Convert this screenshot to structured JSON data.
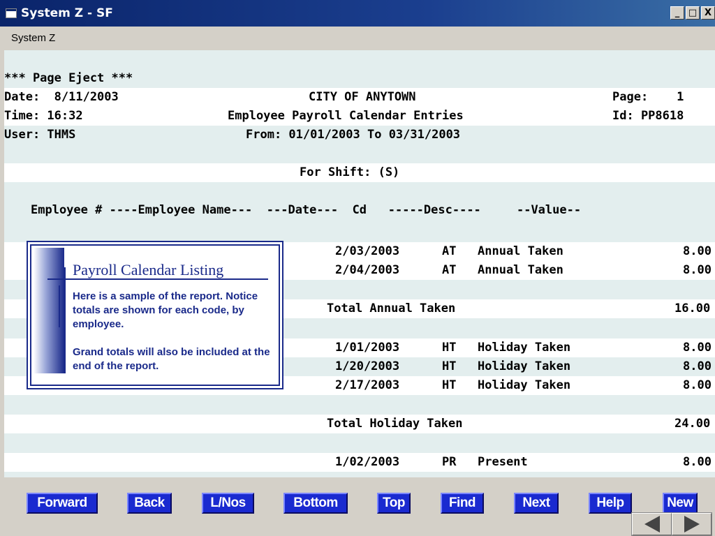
{
  "window": {
    "title": "System Z - SF",
    "minimize": "_",
    "maximize": "□",
    "close": "X"
  },
  "menu": {
    "system": "System Z"
  },
  "report": {
    "page_eject": "*** Page Eject ***",
    "date_label": "Date:  8/11/2003",
    "city": "CITY OF ANYTOWN",
    "page_label": "Page:    1",
    "time_label": "Time: 16:32",
    "report_title": "Employee Payroll Calendar Entries",
    "id_label": "Id: PP8618",
    "user_label": "User: THMS",
    "range": "From: 01/01/2003 To 03/31/2003",
    "shift": "For Shift: (S)",
    "col_header": "Employee # ----Employee Name---  ---Date---  Cd   -----Desc----     --Value--",
    "rows": [
      {
        "date": "2/03/2003",
        "cd": "AT",
        "desc": "Annual Taken",
        "value": "8.00"
      },
      {
        "date": "2/04/2003",
        "cd": "AT",
        "desc": "Annual Taken",
        "value": "8.00"
      },
      {
        "total_label": "Total Annual Taken",
        "value": "16.00"
      },
      {
        "date": "1/01/2003",
        "cd": "HT",
        "desc": "Holiday Taken",
        "value": "8.00"
      },
      {
        "date": "1/20/2003",
        "cd": "HT",
        "desc": "Holiday Taken",
        "value": "8.00"
      },
      {
        "date": "2/17/2003",
        "cd": "HT",
        "desc": "Holiday Taken",
        "value": "8.00"
      },
      {
        "total_label": "Total Holiday Taken",
        "value": "24.00"
      },
      {
        "date": "1/02/2003",
        "cd": "PR",
        "desc": "Present",
        "value": "8.00"
      }
    ]
  },
  "callout": {
    "title": "Payroll Calendar Listing",
    "para1": "Here is a sample of the report. Notice totals are shown for each code, by employee.",
    "para2": "Grand totals will also  be included at the end of the report."
  },
  "fkeys": [
    "Forward",
    "Back",
    "L/Nos",
    "Bottom",
    "Top",
    "Find",
    "Next",
    "Help",
    "New"
  ],
  "icons": {
    "prev": "prev-slide-icon",
    "next": "next-slide-icon"
  }
}
